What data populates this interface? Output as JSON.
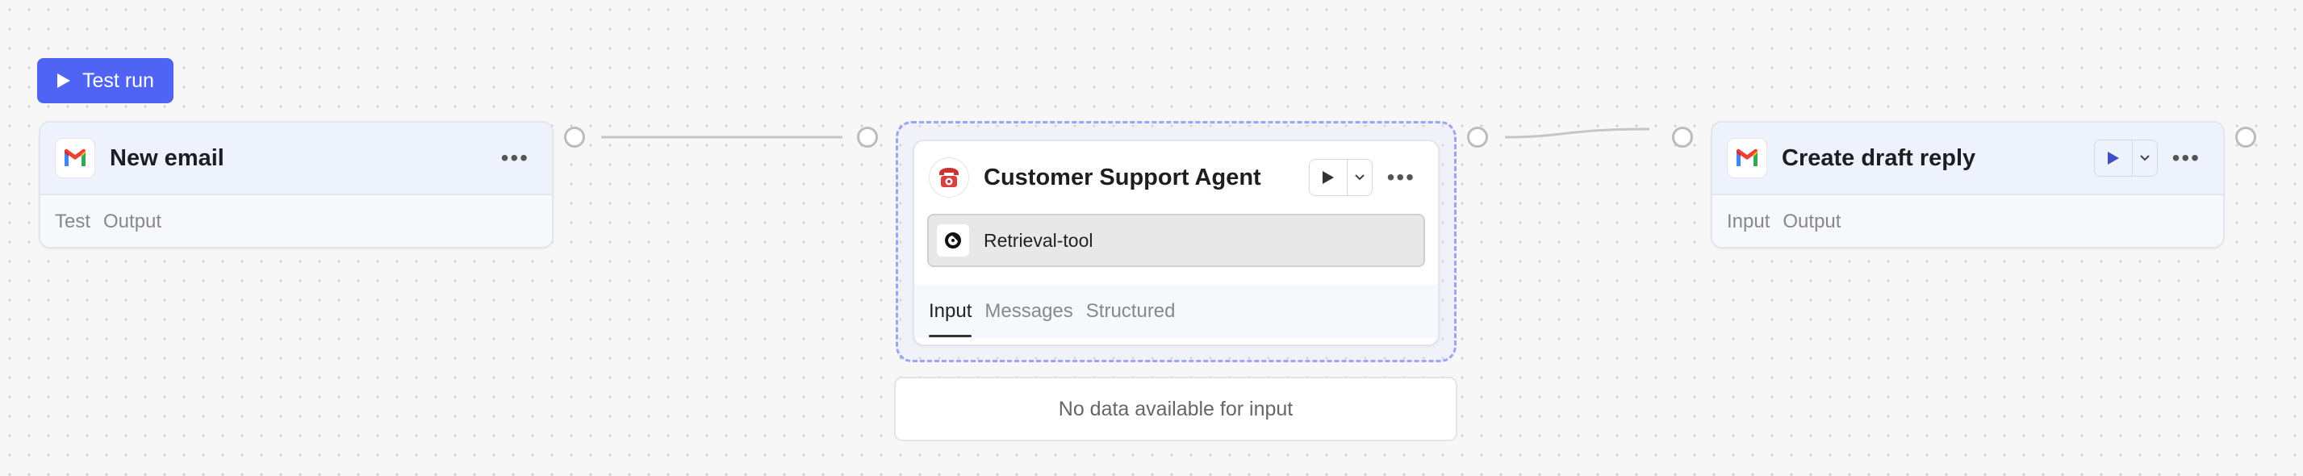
{
  "toolbar": {
    "test_run_label": "Test run"
  },
  "nodes": {
    "new_email": {
      "title": "New email",
      "tabs": [
        "Test",
        "Output"
      ]
    },
    "agent": {
      "title": "Customer Support Agent",
      "tool_label": "Retrieval-tool",
      "tabs": [
        "Input",
        "Messages",
        "Structured"
      ],
      "empty_message": "No data available for input"
    },
    "draft_reply": {
      "title": "Create draft reply",
      "tabs": [
        "Input",
        "Output"
      ]
    }
  },
  "colors": {
    "accent": "#4f63f5",
    "selection": "#9ba5f1",
    "gmail_red": "#ea4335",
    "gmail_blue": "#4285f4",
    "gmail_green": "#34a853",
    "gmail_yellow": "#fbbc04"
  },
  "icons": [
    "play-icon",
    "gmail-icon",
    "more-icon",
    "telephone-icon",
    "retrieval-tool-icon",
    "chevron-down-icon"
  ]
}
